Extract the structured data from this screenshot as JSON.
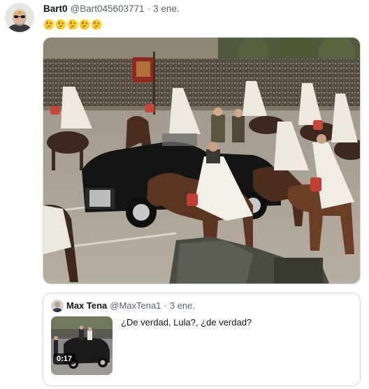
{
  "tweet": {
    "display_name": "Bart0",
    "handle": "@Bart045603771",
    "separator": "·",
    "date": "3 ene.",
    "emojis": [
      "thinking-face",
      "thinking-face",
      "thinking-face",
      "thinking-face",
      "thinking-face"
    ]
  },
  "quote": {
    "display_name": "Max Tena",
    "handle": "@MaxTena1",
    "separator": "·",
    "date": "3 ene.",
    "text": "¿De verdad, Lula?, ¿de verdad?",
    "video_duration": "0:17"
  },
  "colors": {
    "text": "#0f1419",
    "muted": "#536471",
    "border": "#cfd9de"
  }
}
